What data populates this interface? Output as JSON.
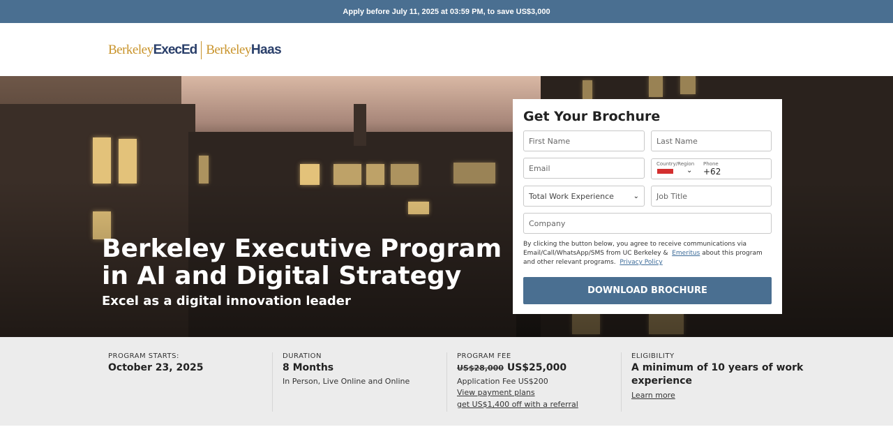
{
  "banner": {
    "text": "Apply before July 11, 2025 at 03:59 PM, to save US$3,000"
  },
  "logo": {
    "part1": "Berkeley",
    "part2": "ExecEd",
    "part3": "Berkeley",
    "part4": "Haas"
  },
  "hero": {
    "title": "Berkeley Executive Program in AI and Digital Strategy",
    "subtitle": "Excel as a digital innovation leader"
  },
  "form": {
    "heading": "Get Your Brochure",
    "first_name_placeholder": "First Name",
    "last_name_placeholder": "Last Name",
    "email_placeholder": "Email",
    "country_label": "Country/Region",
    "phone_label": "Phone",
    "phone_value": "+62",
    "work_experience_value": "Total Work Experience",
    "job_title_placeholder": "Job Title",
    "company_placeholder": "Company",
    "consent_text_1": "By clicking the button below, you agree to receive communications via Email/Call/WhatsApp/SMS from UC Berkeley &",
    "consent_link_1": "Emeritus",
    "consent_text_2": "about this program and other relevant programs.",
    "consent_link_2": "Privacy Policy",
    "button_label": "DOWNLOAD BROCHURE"
  },
  "info": {
    "start": {
      "label": "PROGRAM STARTS:",
      "value": "October 23, 2025"
    },
    "duration": {
      "label": "DURATION",
      "value": "8 Months",
      "detail": "In Person, Live Online and Online"
    },
    "fee": {
      "label": "PROGRAM FEE",
      "old_price": "US$28,000",
      "price": "US$25,000",
      "application_fee": "Application Fee US$200",
      "payment_link": "View payment plans",
      "referral_link": "get US$1,400 off with a referral"
    },
    "eligibility": {
      "label": "ELIGIBILITY",
      "value_line1": "A minimum of 10 years of work",
      "value_line2": "experience",
      "link": "Learn more"
    }
  },
  "colors": {
    "banner": "#4a6f91",
    "button": "#4a6f91",
    "info_bg": "#ececec",
    "flag": "#d32f2f"
  }
}
